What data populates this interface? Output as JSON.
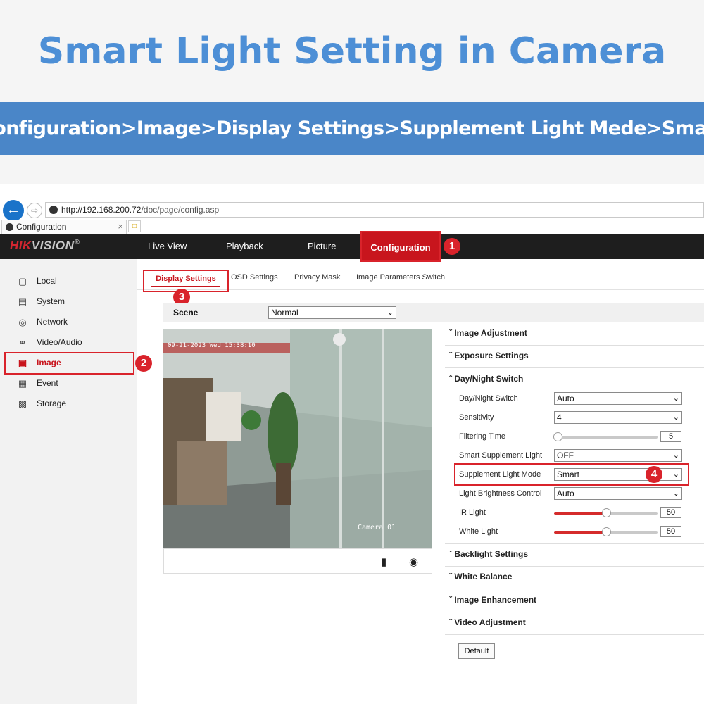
{
  "headline": "Smart Light Setting in Camera",
  "banner": "Configuration>Image>Display Settings>Supplement Light Mede>Smart",
  "browser": {
    "url_host": "http://192.168.200.72",
    "url_path": "/doc/page/config.asp",
    "tab_title": "Configuration",
    "tab_close": "×"
  },
  "app": {
    "logo_main": "HIK",
    "logo_rest": "VISION",
    "logo_reg": "®",
    "nav": [
      "Live View",
      "Playback",
      "Picture",
      "Configuration"
    ]
  },
  "sidebar": {
    "items": [
      {
        "label": "Local",
        "icon": "monitor-icon"
      },
      {
        "label": "System",
        "icon": "system-icon"
      },
      {
        "label": "Network",
        "icon": "globe-icon"
      },
      {
        "label": "Video/Audio",
        "icon": "video-audio-icon"
      },
      {
        "label": "Image",
        "icon": "image-icon"
      },
      {
        "label": "Event",
        "icon": "calendar-icon"
      },
      {
        "label": "Storage",
        "icon": "storage-icon"
      }
    ]
  },
  "subtabs": [
    "Display Settings",
    "OSD Settings",
    "Privacy Mask",
    "Image Parameters Switch"
  ],
  "scene": {
    "label": "Scene",
    "value": "Normal"
  },
  "video": {
    "timestamp": "09-21-2023 Wed 15:38:10",
    "camera_name": "Camera 01"
  },
  "panel": {
    "sections": [
      "Image Adjustment",
      "Exposure Settings",
      "Day/Night Switch",
      "Backlight Settings",
      "White Balance",
      "Image Enhancement",
      "Video Adjustment"
    ],
    "day_night_switch": {
      "label": "Day/Night Switch",
      "value": "Auto"
    },
    "sensitivity": {
      "label": "Sensitivity",
      "value": "4"
    },
    "filtering_time": {
      "label": "Filtering Time",
      "value": "5",
      "level": 0.0
    },
    "smart_supplement_light": {
      "label": "Smart Supplement Light",
      "value": "OFF"
    },
    "supplement_light_mode": {
      "label": "Supplement Light Mode",
      "value": "Smart"
    },
    "light_brightness_control": {
      "label": "Light Brightness Control",
      "value": "Auto"
    },
    "ir_light": {
      "label": "IR Light",
      "value": "50",
      "level": 0.5
    },
    "white_light": {
      "label": "White Light",
      "value": "50",
      "level": 0.5
    },
    "default_button": "Default"
  },
  "badges": [
    "1",
    "2",
    "3",
    "4"
  ],
  "colors": {
    "accent_red": "#d9232b",
    "banner_blue": "#4a86c8",
    "headline_blue": "#4d8fd6"
  }
}
